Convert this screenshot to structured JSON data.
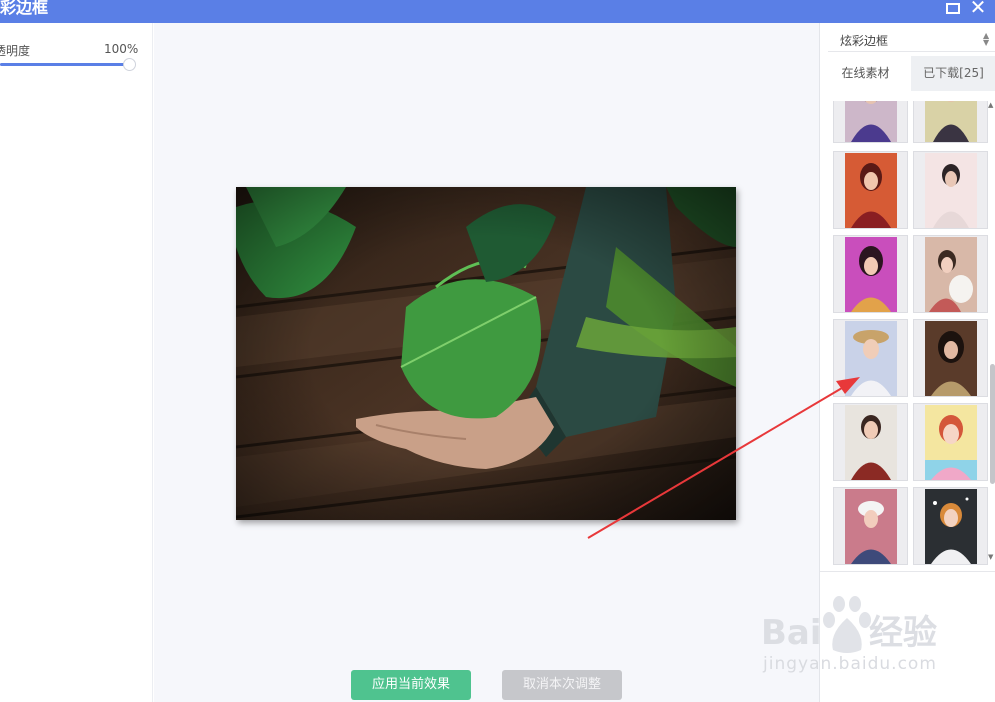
{
  "window": {
    "title": "炫彩边框",
    "icons": {
      "maximize": "maximize-icon",
      "close": "close-icon"
    },
    "close_glyph": "✕"
  },
  "left_panel": {
    "opacity_label": "透明度",
    "opacity_value": "100%",
    "opacity_level": 1.0
  },
  "center": {
    "apply_button": "应用当前效果",
    "cancel_button": "取消本次调整"
  },
  "right_panel": {
    "dropdown_value": "炫彩边框",
    "tabs": [
      {
        "label": "在线素材",
        "active": true
      },
      {
        "label": "已下载[25]",
        "active": false
      }
    ]
  },
  "watermark": {
    "text": "jingyan.baidu.com"
  },
  "colors": {
    "accent": "#5a7fe6",
    "apply": "#4fc38f",
    "cancel": "#c6c7cb",
    "annotation_arrow": "#e8383a"
  }
}
